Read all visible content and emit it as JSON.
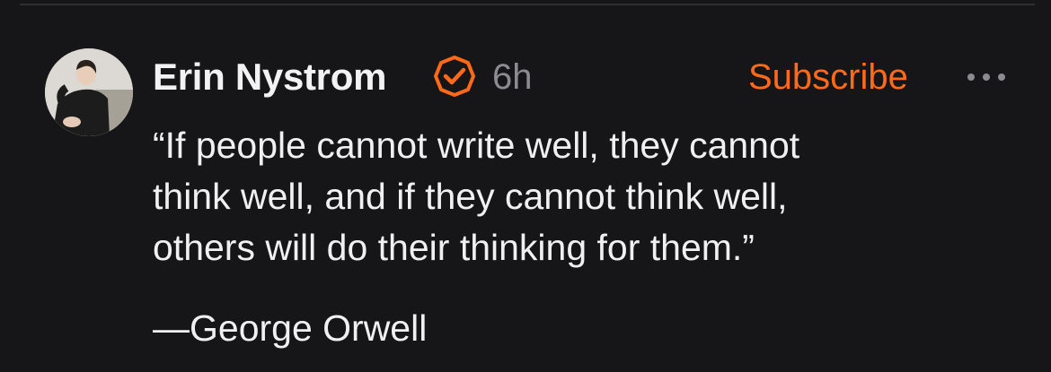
{
  "post": {
    "author_name": "Erin Nystrom",
    "timestamp": "6h",
    "subscribe_label": "Subscribe",
    "quote_lines": [
      "“If people cannot write well, they cannot",
      "think well, and if they cannot think well,",
      "others will do their thinking for them.”"
    ],
    "attribution": "—George Orwell"
  },
  "icons": {
    "verified": "verified-badge-icon",
    "more": "more-options-icon"
  },
  "colors": {
    "background": "#161618",
    "accent": "#ff6a1a",
    "text": "#f0f0f2",
    "muted": "#8c8c90"
  }
}
